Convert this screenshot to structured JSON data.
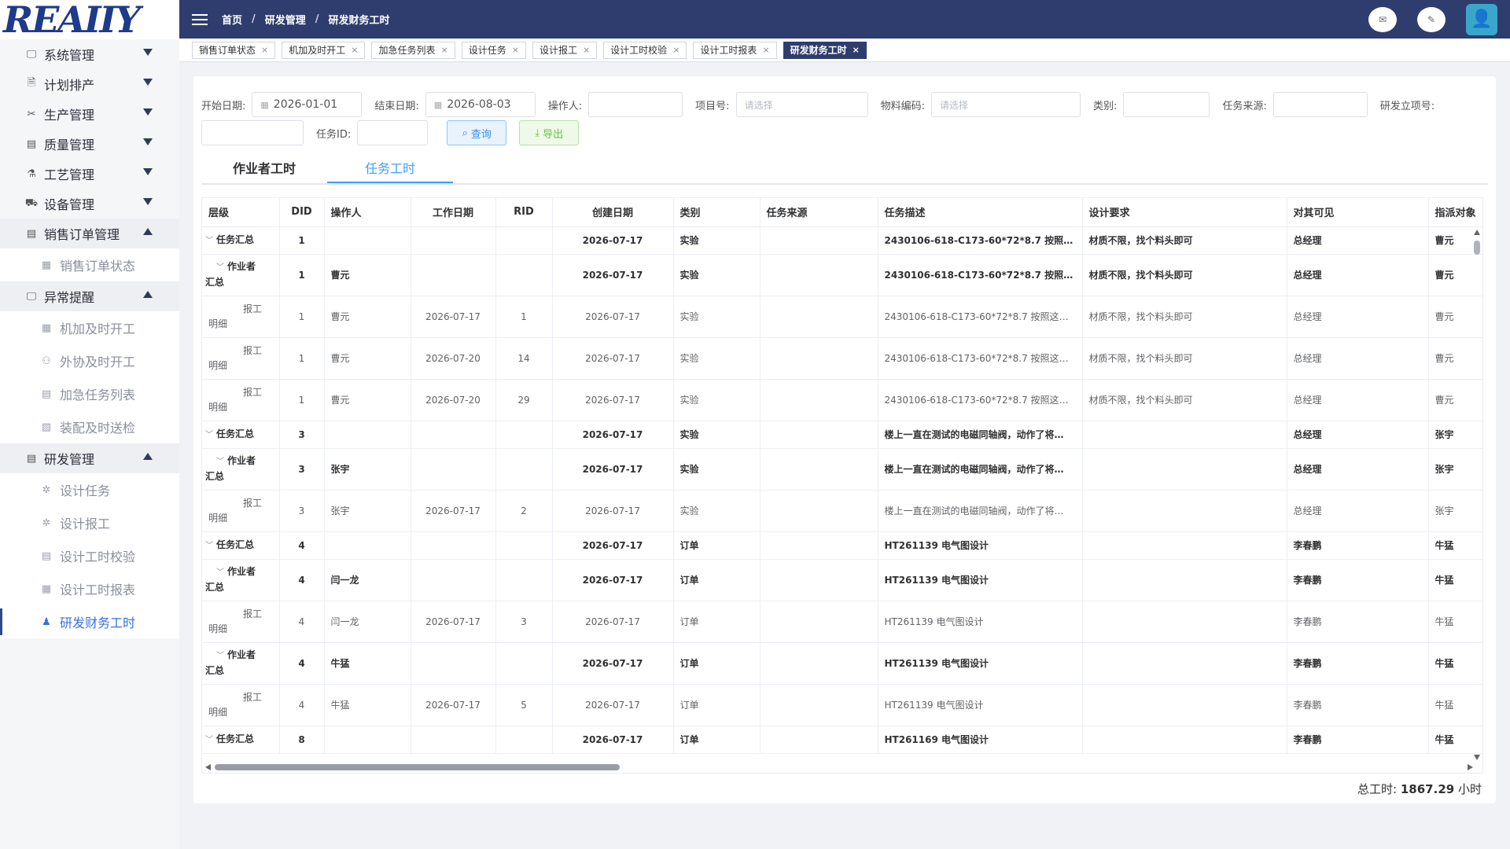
{
  "logo": "REAIIY",
  "sidebar": {
    "menus": [
      {
        "label": "系统管理",
        "icon": "monitor-icon",
        "glyph": "🖵",
        "open": false
      },
      {
        "label": "计划排产",
        "icon": "document-search-icon",
        "glyph": "🗎",
        "open": false
      },
      {
        "label": "生产管理",
        "icon": "tools-icon",
        "glyph": "✂",
        "open": false
      },
      {
        "label": "质量管理",
        "icon": "clipboard-icon",
        "glyph": "▤",
        "open": false
      },
      {
        "label": "工艺管理",
        "icon": "flask-icon",
        "glyph": "⚗",
        "open": false
      },
      {
        "label": "设备管理",
        "icon": "device-icon",
        "glyph": "⛟",
        "open": false
      }
    ],
    "sales": {
      "label": "销售订单管理",
      "icon": "list-icon",
      "glyph": "▤",
      "children": [
        {
          "label": "销售订单状态",
          "icon": "file-icon",
          "glyph": "▦"
        }
      ]
    },
    "alerts": {
      "label": "异常提醒",
      "icon": "monitor-alert-icon",
      "glyph": "🖵",
      "children": [
        {
          "label": "机加及时开工",
          "icon": "table-icon",
          "glyph": "▦"
        },
        {
          "label": "外协及时开工",
          "icon": "user-icon",
          "glyph": "⚇"
        },
        {
          "label": "加急任务列表",
          "icon": "file-list-icon",
          "glyph": "▤"
        },
        {
          "label": "装配及时送检",
          "icon": "inspect-icon",
          "glyph": "▧"
        }
      ]
    },
    "rd": {
      "label": "研发管理",
      "icon": "calendar-icon",
      "glyph": "▤",
      "children": [
        {
          "label": "设计任务",
          "icon": "gear-icon",
          "glyph": "✲"
        },
        {
          "label": "设计报工",
          "icon": "gear-icon",
          "glyph": "✲"
        },
        {
          "label": "设计工时校验",
          "icon": "doc-check-icon",
          "glyph": "▤"
        },
        {
          "label": "设计工时报表",
          "icon": "report-icon",
          "glyph": "▦"
        },
        {
          "label": "研发财务工时",
          "icon": "person-chart-icon",
          "glyph": "♟"
        }
      ]
    }
  },
  "header": {
    "crumbs": [
      "首页",
      "研发管理",
      "研发财务工时"
    ],
    "sep": "/"
  },
  "tabs": [
    {
      "label": "销售订单状态",
      "active": false
    },
    {
      "label": "机加及时开工",
      "active": false
    },
    {
      "label": "加急任务列表",
      "active": false
    },
    {
      "label": "设计任务",
      "active": false
    },
    {
      "label": "设计报工",
      "active": false
    },
    {
      "label": "设计工时校验",
      "active": false
    },
    {
      "label": "设计工时报表",
      "active": false
    },
    {
      "label": "研发财务工时",
      "active": true
    }
  ],
  "filters": {
    "start_label": "开始日期:",
    "start_value": "2026-01-01",
    "end_label": "结束日期:",
    "end_value": "2026-08-03",
    "operator_label": "操作人:",
    "operator_value": "",
    "project_label": "项目号:",
    "project_placeholder": "请选择",
    "material_label": "物料编码:",
    "material_placeholder": "请选择",
    "category_label": "类别:",
    "category_value": "",
    "source_label": "任务来源:",
    "source_value": "",
    "rd_label": "研发立项号:",
    "rd_value": "",
    "taskid_label": "任务ID:",
    "taskid_value": "",
    "query_label": "查询",
    "export_label": "导出"
  },
  "subtabs": [
    {
      "label": "作业者工时",
      "active": false
    },
    {
      "label": "任务工时",
      "active": true
    }
  ],
  "table": {
    "headers": [
      "层级",
      "DID",
      "操作人",
      "工作日期",
      "RID",
      "创建日期",
      "类别",
      "任务来源",
      "任务描述",
      "设计要求",
      "对其可见",
      "指派对象"
    ],
    "rows": [
      {
        "type": "sum",
        "lvl1": "任务汇总",
        "lvl2": "",
        "did": "1",
        "op": "",
        "work": "",
        "rid": "",
        "created": "2026-07-17",
        "cat": "实验",
        "src": "",
        "desc": "2430106-618-C173-60*72*8.7 按照这个…",
        "req": "材质不限，找个料头即可",
        "vis": "总经理",
        "assign": "曹元"
      },
      {
        "type": "worker",
        "lvl1": "作业者",
        "lvl2": "汇总",
        "did": "1",
        "op": "曹元",
        "work": "",
        "rid": "",
        "created": "2026-07-17",
        "cat": "实验",
        "src": "",
        "desc": "2430106-618-C173-60*72*8.7 按照这个…",
        "req": "材质不限，找个料头即可",
        "vis": "总经理",
        "assign": "曹元"
      },
      {
        "type": "detail",
        "lvl1": "报工",
        "lvl2": "明细",
        "did": "1",
        "op": "曹元",
        "work": "2026-07-17",
        "rid": "1",
        "created": "2026-07-17",
        "cat": "实验",
        "src": "",
        "desc": "2430106-618-C173-60*72*8.7 按照这个…",
        "req": "材质不限，找个料头即可",
        "vis": "总经理",
        "assign": "曹元"
      },
      {
        "type": "detail",
        "lvl1": "报工",
        "lvl2": "明细",
        "did": "1",
        "op": "曹元",
        "work": "2026-07-20",
        "rid": "14",
        "created": "2026-07-17",
        "cat": "实验",
        "src": "",
        "desc": "2430106-618-C173-60*72*8.7 按照这个…",
        "req": "材质不限，找个料头即可",
        "vis": "总经理",
        "assign": "曹元"
      },
      {
        "type": "detail",
        "lvl1": "报工",
        "lvl2": "明细",
        "did": "1",
        "op": "曹元",
        "work": "2026-07-20",
        "rid": "29",
        "created": "2026-07-17",
        "cat": "实验",
        "src": "",
        "desc": "2430106-618-C173-60*72*8.7 按照这个…",
        "req": "材质不限，找个料头即可",
        "vis": "总经理",
        "assign": "曹元"
      },
      {
        "type": "sum",
        "lvl1": "任务汇总",
        "lvl2": "",
        "did": "3",
        "op": "",
        "work": "",
        "rid": "",
        "created": "2026-07-17",
        "cat": "实验",
        "src": "",
        "desc": "楼上一直在测试的电磁同轴阀，动作了将…",
        "req": "",
        "vis": "总经理",
        "assign": "张宇"
      },
      {
        "type": "worker",
        "lvl1": "作业者",
        "lvl2": "汇总",
        "did": "3",
        "op": "张宇",
        "work": "",
        "rid": "",
        "created": "2026-07-17",
        "cat": "实验",
        "src": "",
        "desc": "楼上一直在测试的电磁同轴阀，动作了将…",
        "req": "",
        "vis": "总经理",
        "assign": "张宇"
      },
      {
        "type": "detail",
        "lvl1": "报工",
        "lvl2": "明细",
        "did": "3",
        "op": "张宇",
        "work": "2026-07-17",
        "rid": "2",
        "created": "2026-07-17",
        "cat": "实验",
        "src": "",
        "desc": "楼上一直在测试的电磁同轴阀，动作了将…",
        "req": "",
        "vis": "总经理",
        "assign": "张宇"
      },
      {
        "type": "sum",
        "lvl1": "任务汇总",
        "lvl2": "",
        "did": "4",
        "op": "",
        "work": "",
        "rid": "",
        "created": "2026-07-17",
        "cat": "订单",
        "src": "",
        "desc": "HT261139 电气图设计",
        "req": "",
        "vis": "李春鹏",
        "assign": "牛猛"
      },
      {
        "type": "worker",
        "lvl1": "作业者",
        "lvl2": "汇总",
        "did": "4",
        "op": "闫一龙",
        "work": "",
        "rid": "",
        "created": "2026-07-17",
        "cat": "订单",
        "src": "",
        "desc": "HT261139 电气图设计",
        "req": "",
        "vis": "李春鹏",
        "assign": "牛猛"
      },
      {
        "type": "detail",
        "lvl1": "报工",
        "lvl2": "明细",
        "did": "4",
        "op": "闫一龙",
        "work": "2026-07-17",
        "rid": "3",
        "created": "2026-07-17",
        "cat": "订单",
        "src": "",
        "desc": "HT261139 电气图设计",
        "req": "",
        "vis": "李春鹏",
        "assign": "牛猛"
      },
      {
        "type": "worker",
        "lvl1": "作业者",
        "lvl2": "汇总",
        "did": "4",
        "op": "牛猛",
        "work": "",
        "rid": "",
        "created": "2026-07-17",
        "cat": "订单",
        "src": "",
        "desc": "HT261139 电气图设计",
        "req": "",
        "vis": "李春鹏",
        "assign": "牛猛"
      },
      {
        "type": "detail",
        "lvl1": "报工",
        "lvl2": "明细",
        "did": "4",
        "op": "牛猛",
        "work": "2026-07-17",
        "rid": "5",
        "created": "2026-07-17",
        "cat": "订单",
        "src": "",
        "desc": "HT261139 电气图设计",
        "req": "",
        "vis": "李春鹏",
        "assign": "牛猛"
      },
      {
        "type": "sum",
        "lvl1": "任务汇总",
        "lvl2": "",
        "did": "8",
        "op": "",
        "work": "",
        "rid": "",
        "created": "2026-07-17",
        "cat": "订单",
        "src": "",
        "desc": "HT261169 电气图设计",
        "req": "",
        "vis": "李春鹏",
        "assign": "牛猛"
      }
    ]
  },
  "footer": {
    "total_label": "总工时:",
    "total_value": "1867.29",
    "unit": "小时"
  }
}
